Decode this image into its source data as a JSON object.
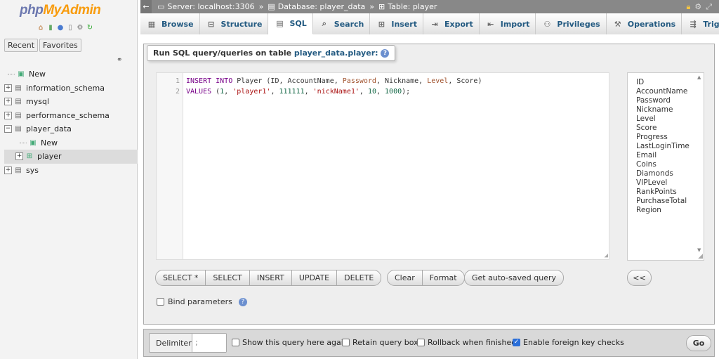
{
  "logo": {
    "php": "php",
    "my": "My",
    "admin": "Admin"
  },
  "nav": {
    "tabs": [
      "Recent",
      "Favorites"
    ],
    "tree": [
      {
        "label": "New",
        "level": 0,
        "expander": "",
        "icon": "new-icon"
      },
      {
        "label": "information_schema",
        "level": 0,
        "expander": "+",
        "icon": "database-icon"
      },
      {
        "label": "mysql",
        "level": 0,
        "expander": "+",
        "icon": "database-icon"
      },
      {
        "label": "performance_schema",
        "level": 0,
        "expander": "+",
        "icon": "database-icon"
      },
      {
        "label": "player_data",
        "level": 0,
        "expander": "−",
        "icon": "database-icon"
      },
      {
        "label": "New",
        "level": 1,
        "expander": "",
        "icon": "new-icon"
      },
      {
        "label": "player",
        "level": 1,
        "expander": "+",
        "icon": "table-icon",
        "selected": true
      },
      {
        "label": "sys",
        "level": 0,
        "expander": "+",
        "icon": "database-icon"
      }
    ]
  },
  "breadcrumb": {
    "server": "Server: localhost:3306",
    "database": "Database: player_data",
    "table": "Table: player",
    "sep": "»"
  },
  "tabs": [
    {
      "label": "Browse",
      "icon": "browse-icon"
    },
    {
      "label": "Structure",
      "icon": "structure-icon"
    },
    {
      "label": "SQL",
      "icon": "sql-icon",
      "active": true
    },
    {
      "label": "Search",
      "icon": "search-icon"
    },
    {
      "label": "Insert",
      "icon": "insert-icon"
    },
    {
      "label": "Export",
      "icon": "export-icon"
    },
    {
      "label": "Import",
      "icon": "import-icon"
    },
    {
      "label": "Privileges",
      "icon": "privileges-icon"
    },
    {
      "label": "Operations",
      "icon": "operations-icon"
    },
    {
      "label": "Triggers",
      "icon": "triggers-icon"
    }
  ],
  "legend": {
    "prefix": "Run SQL query/queries on table ",
    "table": "player_data.player:"
  },
  "editor": {
    "line_numbers": [
      "1",
      "2"
    ],
    "line1": {
      "kw1": "INSERT INTO",
      "t1": " Player (ID, AccountName, ",
      "v1": "Password",
      "t2": ", Nickname, ",
      "v2": "Level",
      "t3": ", Score)"
    },
    "line2": {
      "kw1": "VALUES",
      "t1": " (",
      "n1": "1",
      "t2": ", ",
      "s1": "'player1'",
      "t3": ", ",
      "n2": "111111",
      "t4": ", ",
      "s2": "'nickName1'",
      "t5": ", ",
      "n3": "10",
      "t6": ", ",
      "n4": "1000",
      "t7": ");"
    }
  },
  "columns": [
    "ID",
    "AccountName",
    "Password",
    "Nickname",
    "Level",
    "Score",
    "Progress",
    "LastLoginTime",
    "Email",
    "Coins",
    "Diamonds",
    "VIPLevel",
    "RankPoints",
    "PurchaseTotal",
    "Region"
  ],
  "buttons": {
    "snippets": [
      "SELECT *",
      "SELECT",
      "INSERT",
      "UPDATE",
      "DELETE"
    ],
    "clear": "Clear",
    "format": "Format",
    "autosaved": "Get auto-saved query",
    "insert_col": "<<"
  },
  "bind_params": {
    "label": "Bind parameters",
    "checked": false
  },
  "footer": {
    "delimiter_label": "Delimiter",
    "delimiter_value": ";",
    "options": [
      {
        "label": "Show this query here again",
        "checked": false
      },
      {
        "label": "Retain query box",
        "checked": false
      },
      {
        "label": "Rollback when finished",
        "checked": false
      },
      {
        "label": "Enable foreign key checks",
        "checked": true
      }
    ],
    "go": "Go"
  }
}
